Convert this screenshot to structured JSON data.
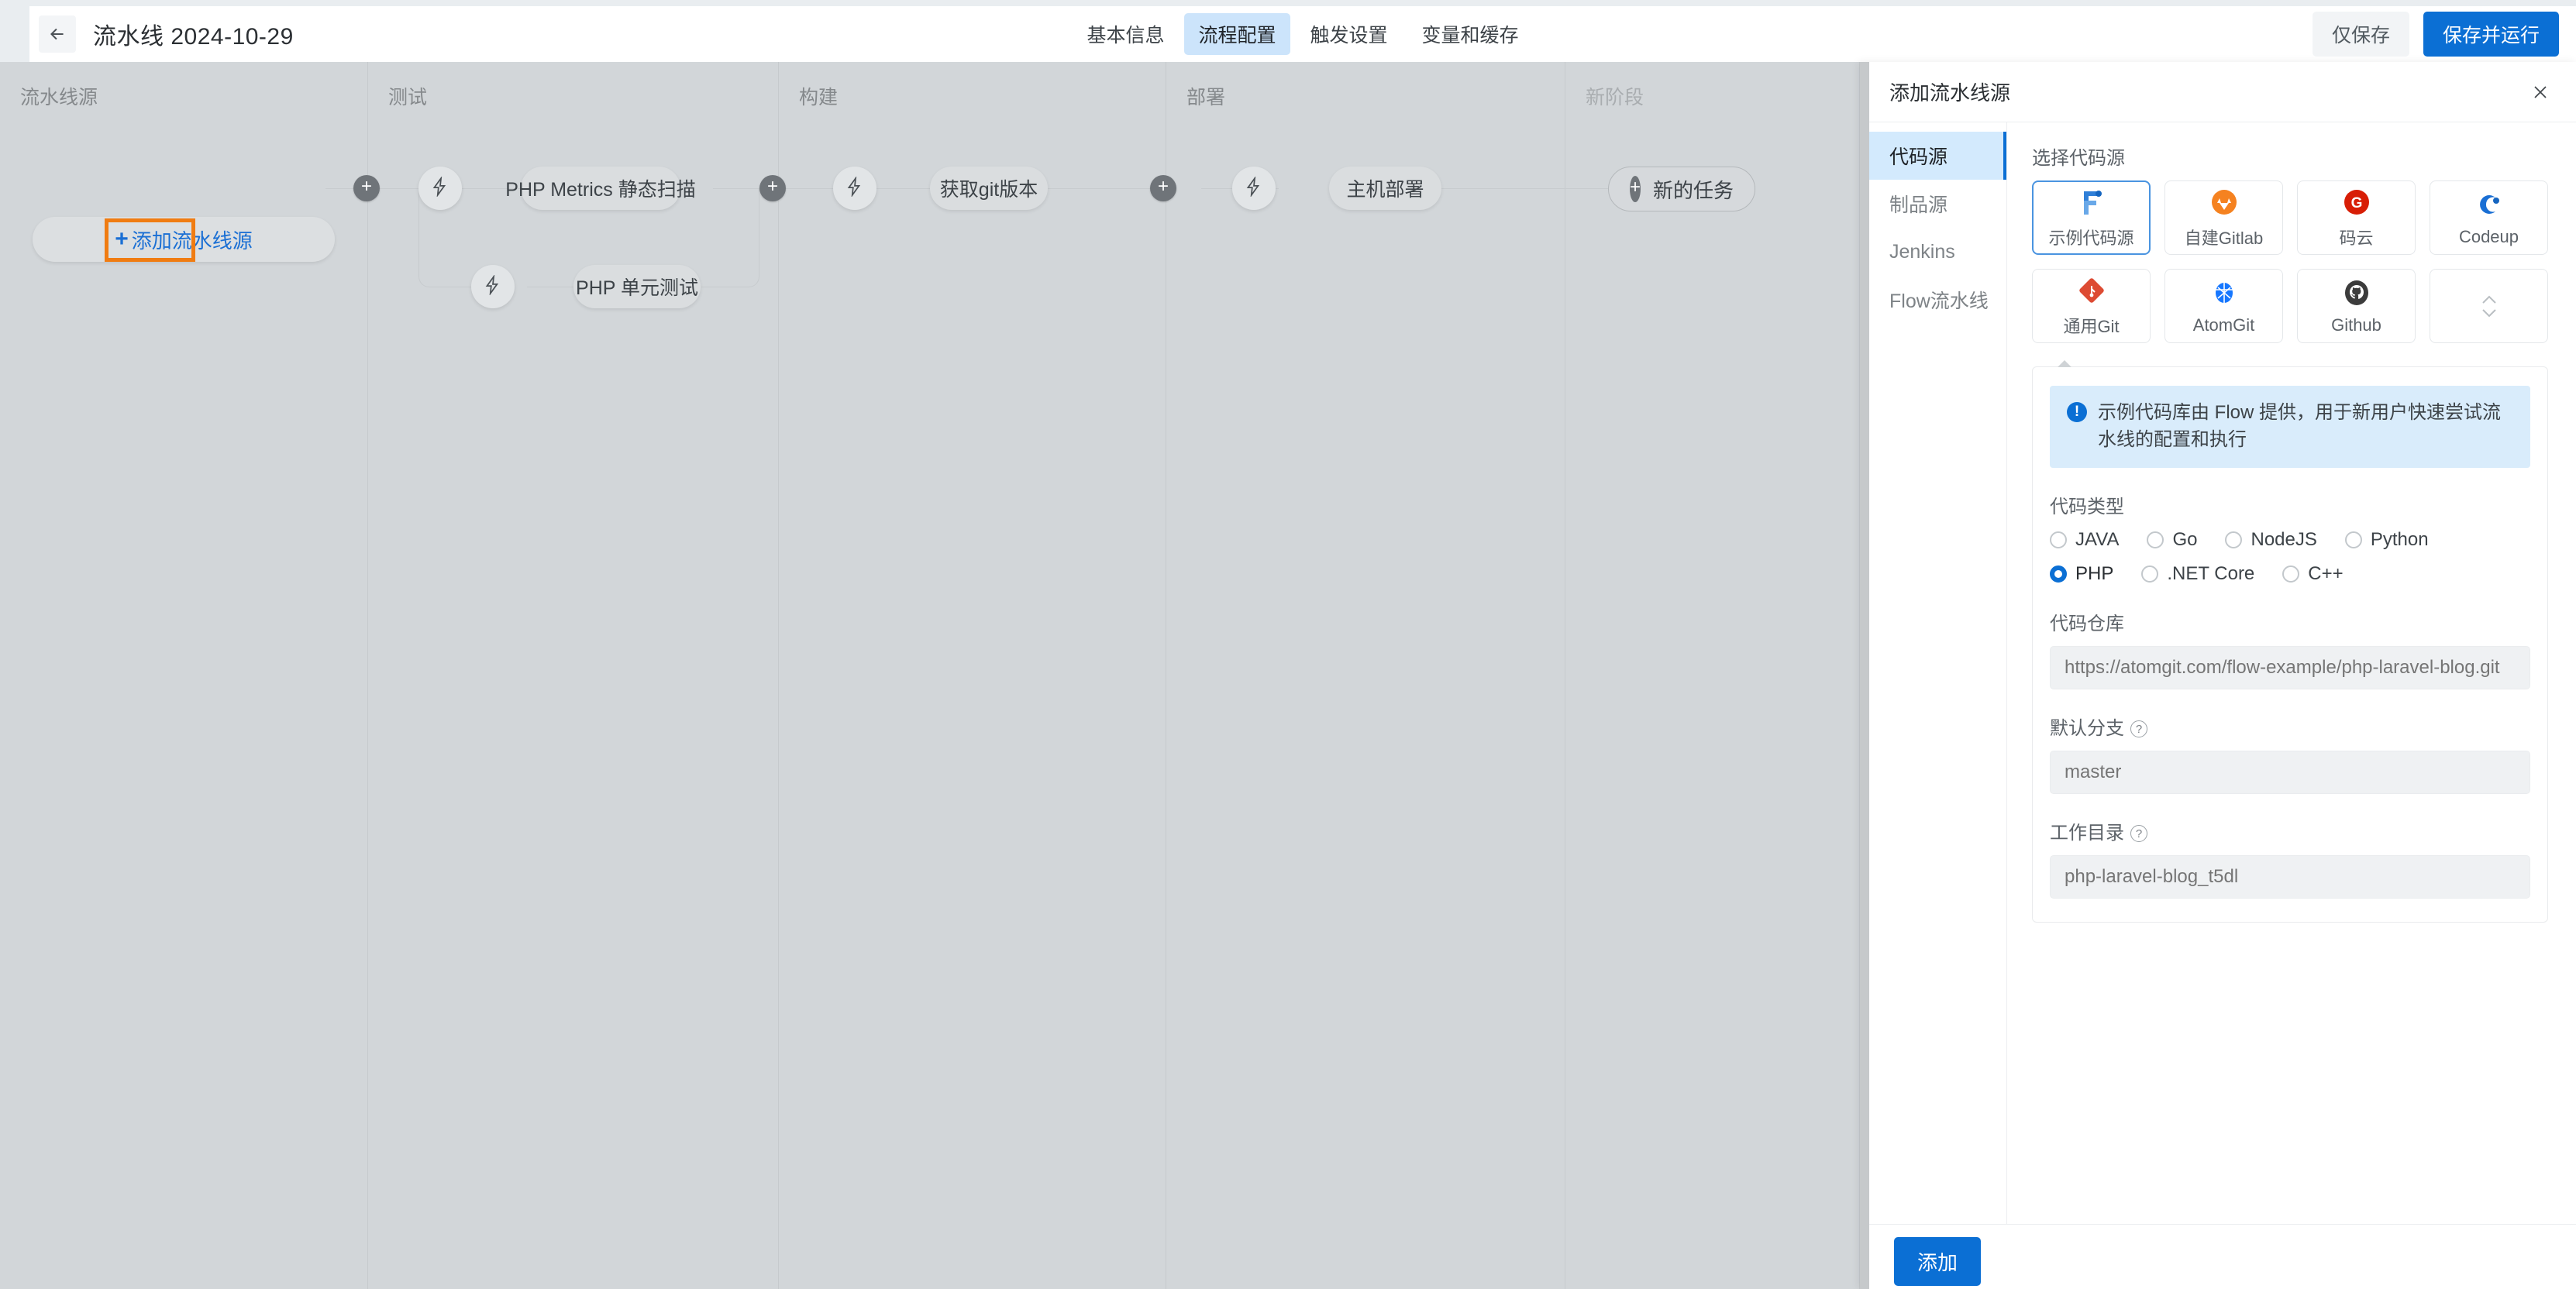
{
  "header": {
    "back_icon": "arrow-left-icon",
    "title": "流水线 2024-10-29",
    "tabs": [
      {
        "label": "基本信息",
        "active": false
      },
      {
        "label": "流程配置",
        "active": true
      },
      {
        "label": "触发设置",
        "active": false
      },
      {
        "label": "变量和缓存",
        "active": false
      }
    ],
    "save_only_label": "仅保存",
    "save_run_label": "保存并运行"
  },
  "pipeline": {
    "stages": [
      {
        "label": "流水线源",
        "dim": false
      },
      {
        "label": "测试",
        "dim": false
      },
      {
        "label": "构建",
        "dim": false
      },
      {
        "label": "部署",
        "dim": false
      },
      {
        "label": "新阶段",
        "dim": true
      }
    ],
    "source_add_label": "添加流水线源",
    "source_add_plus": "+",
    "tasks": {
      "test_1": "PHP Metrics 静态扫描",
      "test_2": "PHP 单元测试",
      "build_1": "获取git版本",
      "deploy_1": "主机部署"
    },
    "new_task_label": "新的任务",
    "new_task_plus": "+",
    "add_plus": "+",
    "highlight_color": "#f07c12"
  },
  "drawer": {
    "title": "添加流水线源",
    "close_icon": "close-icon",
    "nav": [
      {
        "label": "代码源",
        "active": true
      },
      {
        "label": "制品源",
        "active": false
      },
      {
        "label": "Jenkins",
        "active": false
      },
      {
        "label": "Flow流水线",
        "active": false
      }
    ],
    "select_source_label": "选择代码源",
    "sources": [
      {
        "name": "示例代码源",
        "icon": "flow-f-logo-icon",
        "selected": true
      },
      {
        "name": "自建Gitlab",
        "icon": "gitlab-logo-icon",
        "selected": false
      },
      {
        "name": "码云",
        "icon": "gitee-logo-icon",
        "selected": false
      },
      {
        "name": "Codeup",
        "icon": "codeup-logo-icon",
        "selected": false
      },
      {
        "name": "通用Git",
        "icon": "git-logo-icon",
        "selected": false
      },
      {
        "name": "AtomGit",
        "icon": "atomgit-logo-icon",
        "selected": false
      },
      {
        "name": "Github",
        "icon": "github-logo-icon",
        "selected": false
      },
      {
        "name": "",
        "icon": "chevron-up-down-icon",
        "selected": false
      }
    ],
    "info_text": "示例代码库由 Flow 提供，用于新用户快速尝试流水线的配置和执行",
    "code_type": {
      "label": "代码类型",
      "row1": [
        {
          "label": "JAVA",
          "checked": false
        },
        {
          "label": "Go",
          "checked": false
        },
        {
          "label": "NodeJS",
          "checked": false
        },
        {
          "label": "Python",
          "checked": false
        }
      ],
      "row2": [
        {
          "label": "PHP",
          "checked": true
        },
        {
          "label": ".NET Core",
          "checked": false
        },
        {
          "label": "C++",
          "checked": false
        }
      ]
    },
    "repo": {
      "label": "代码仓库",
      "value": "https://atomgit.com/flow-example/php-laravel-blog.git"
    },
    "branch": {
      "label": "默认分支",
      "help_icon": "question-circle-icon",
      "value": "master"
    },
    "workdir": {
      "label": "工作目录",
      "help_icon": "question-circle-icon",
      "value": "php-laravel-blog_t5dl"
    },
    "add_button_label": "添加",
    "accent": "#0b6fd4"
  }
}
